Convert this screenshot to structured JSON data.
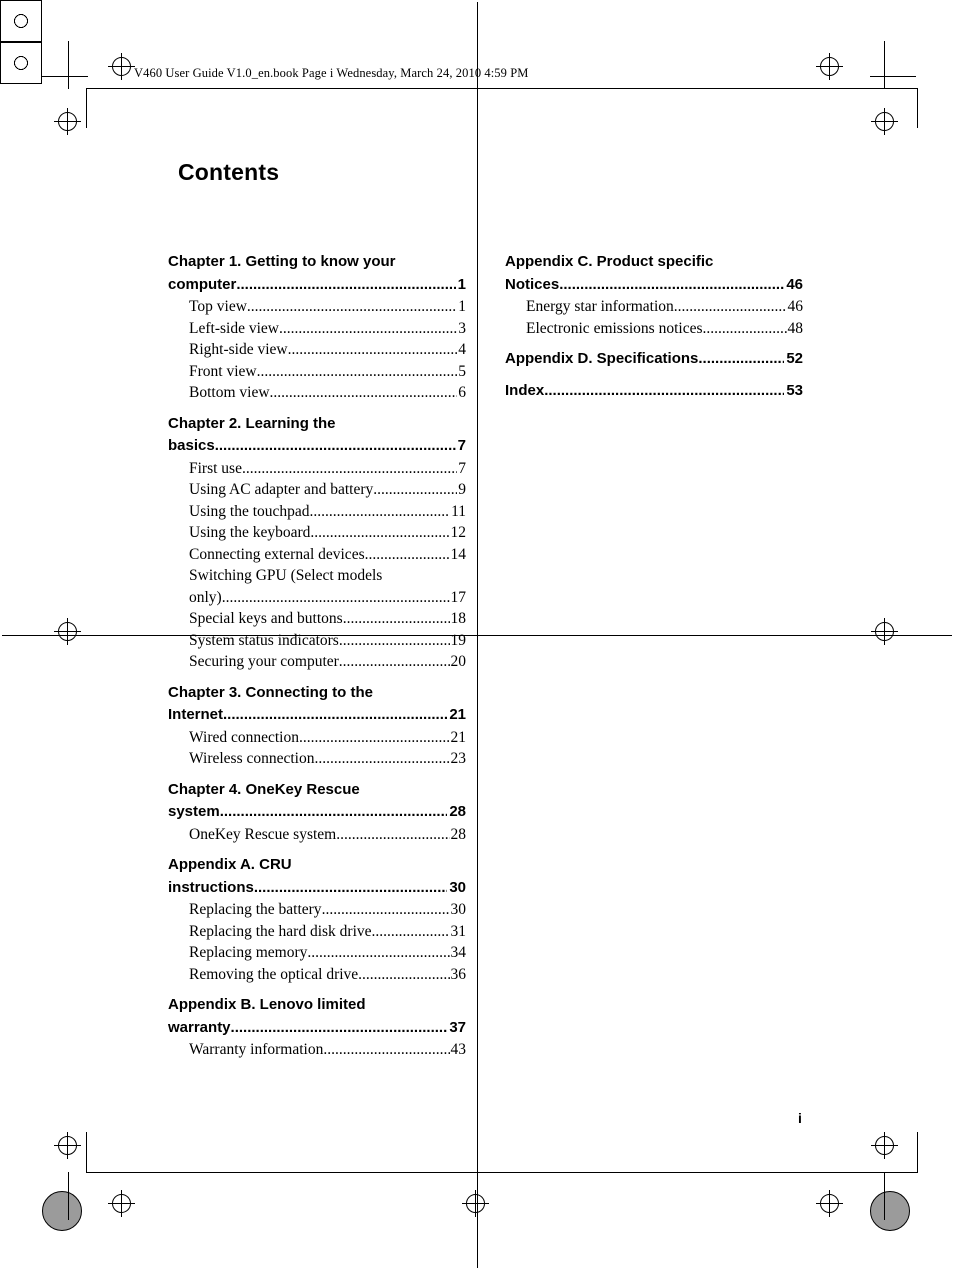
{
  "header": {
    "running_head": "V460 User Guide V1.0_en.book  Page i  Wednesday, March 24, 2010  4:59 PM"
  },
  "page": {
    "title": "Contents",
    "folio": "i"
  },
  "toc": {
    "dot_leader": "..................................................................................................",
    "left_column": [
      {
        "type": "chapter",
        "lines": [
          "Chapter 1. Getting to know your",
          "computer"
        ],
        "page": "1"
      },
      {
        "type": "section",
        "label": "Top view",
        "page": "1"
      },
      {
        "type": "section",
        "label": "Left-side view",
        "page": "3"
      },
      {
        "type": "section",
        "label": "Right-side view",
        "page": "4"
      },
      {
        "type": "section",
        "label": "Front view",
        "page": "5"
      },
      {
        "type": "section",
        "label": "Bottom view",
        "page": "6"
      },
      {
        "type": "chapter",
        "lines": [
          "Chapter 2. Learning the",
          "basics"
        ],
        "page": "7"
      },
      {
        "type": "section",
        "label": "First use",
        "page": "7"
      },
      {
        "type": "section",
        "label": "Using AC adapter and battery",
        "page": "9"
      },
      {
        "type": "section",
        "label": "Using the touchpad",
        "page": "11"
      },
      {
        "type": "section",
        "label": "Using the keyboard",
        "page": "12"
      },
      {
        "type": "section",
        "label": "Connecting external devices",
        "page": "14"
      },
      {
        "type": "section-wrap",
        "label": "Switching GPU (Select models",
        "label2": "only)",
        "page": "17"
      },
      {
        "type": "section",
        "label": "Special keys and buttons",
        "page": "18"
      },
      {
        "type": "section",
        "label": "System status indicators",
        "page": "19"
      },
      {
        "type": "section",
        "label": "Securing your computer",
        "page": "20"
      },
      {
        "type": "chapter",
        "lines": [
          "Chapter 3. Connecting to the",
          "Internet"
        ],
        "page": "21"
      },
      {
        "type": "section",
        "label": "Wired connection",
        "page": "21"
      },
      {
        "type": "section",
        "label": "Wireless connection",
        "page": "23"
      },
      {
        "type": "chapter",
        "lines": [
          "Chapter 4. OneKey Rescue",
          "system"
        ],
        "page": "28"
      },
      {
        "type": "section",
        "label": "OneKey Rescue system",
        "page": "28"
      },
      {
        "type": "chapter",
        "lines": [
          "Appendix A. CRU",
          "instructions"
        ],
        "page": "30"
      },
      {
        "type": "section",
        "label": "Replacing the battery",
        "page": "30"
      },
      {
        "type": "section",
        "label": "Replacing the hard disk drive",
        "page": "31"
      },
      {
        "type": "section",
        "label": "Replacing memory",
        "page": "34"
      },
      {
        "type": "section",
        "label": "Removing the optical drive",
        "page": "36"
      },
      {
        "type": "chapter",
        "lines": [
          "Appendix B. Lenovo limited",
          "warranty"
        ],
        "page": "37"
      },
      {
        "type": "section",
        "label": "Warranty information",
        "page": "43"
      }
    ],
    "right_column": [
      {
        "type": "chapter",
        "lines": [
          "Appendix C. Product specific",
          "Notices"
        ],
        "page": "46"
      },
      {
        "type": "section",
        "label": "Energy star information",
        "page": "46"
      },
      {
        "type": "section",
        "label": "Electronic emissions notices",
        "page": "48"
      },
      {
        "type": "chapter",
        "lines": [
          "Appendix D. Specifications"
        ],
        "page": "52"
      },
      {
        "type": "chapter",
        "lines": [
          "Index"
        ],
        "page": "53"
      }
    ]
  }
}
